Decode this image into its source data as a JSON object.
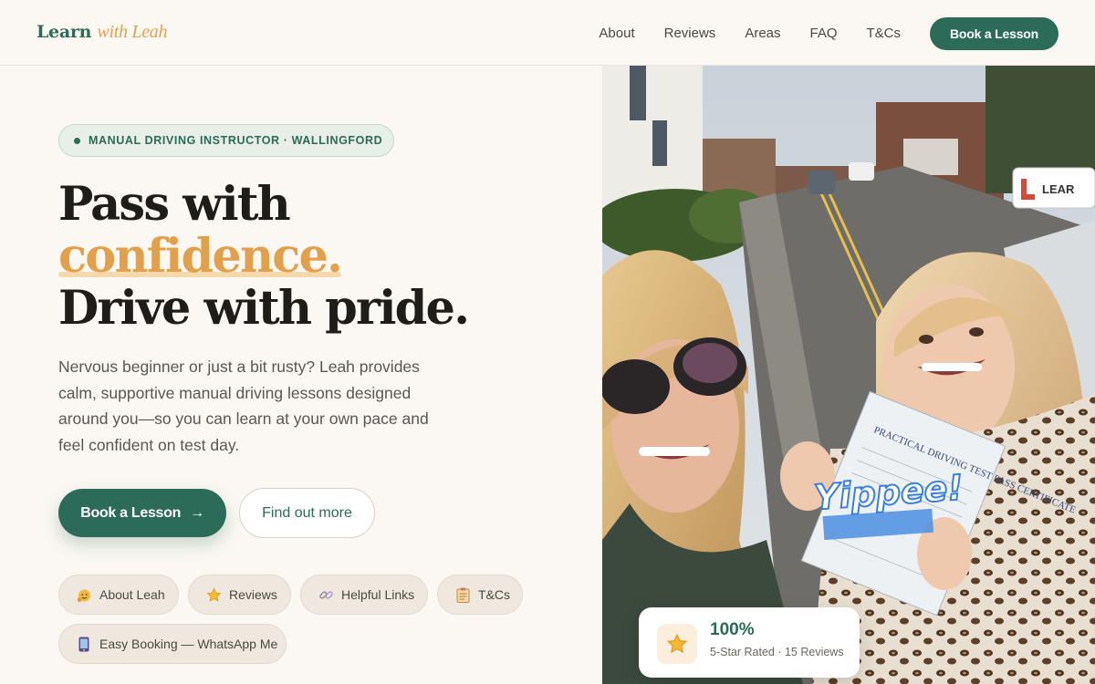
{
  "brand": {
    "name_main": "Learn",
    "name_accent": "with Leah"
  },
  "nav": {
    "links": [
      "About",
      "Reviews",
      "Areas",
      "FAQ",
      "T&Cs"
    ],
    "cta_label": "Book a Lesson"
  },
  "hero": {
    "tag": "MANUAL DRIVING INSTRUCTOR · WALLINGFORD",
    "headline_line1": "Pass with",
    "headline_accent": "confidence.",
    "headline_line3": "Drive with pride.",
    "subcopy": "Nervous beginner or just a bit rusty? Leah provides calm, supportive manual driving lessons designed around you—so you can learn at your own pace and feel confident on test day.",
    "primary_cta": "Book a Lesson",
    "secondary_cta": "Find out more"
  },
  "chips": [
    {
      "label": "About Leah",
      "icon": "waving-person-icon"
    },
    {
      "label": "Reviews",
      "icon": "star-icon"
    },
    {
      "label": "Helpful Links",
      "icon": "link-icon"
    },
    {
      "label": "T&Cs",
      "icon": "clipboard-icon"
    },
    {
      "label": "Easy Booking — WhatsApp Me",
      "icon": "phone-icon"
    }
  ],
  "photo": {
    "sticker_text": "Yippee!",
    "roof_sign_text": "LEAR",
    "certificate_text": "PRACTICAL DRIVING TEST PASS CERTIFICATE"
  },
  "stat": {
    "value": "100%",
    "label": "5-Star Rated · 15 Reviews"
  },
  "colors": {
    "primary": "#2b6b58",
    "accent": "#e3a04a",
    "background": "#fbf8f3"
  }
}
